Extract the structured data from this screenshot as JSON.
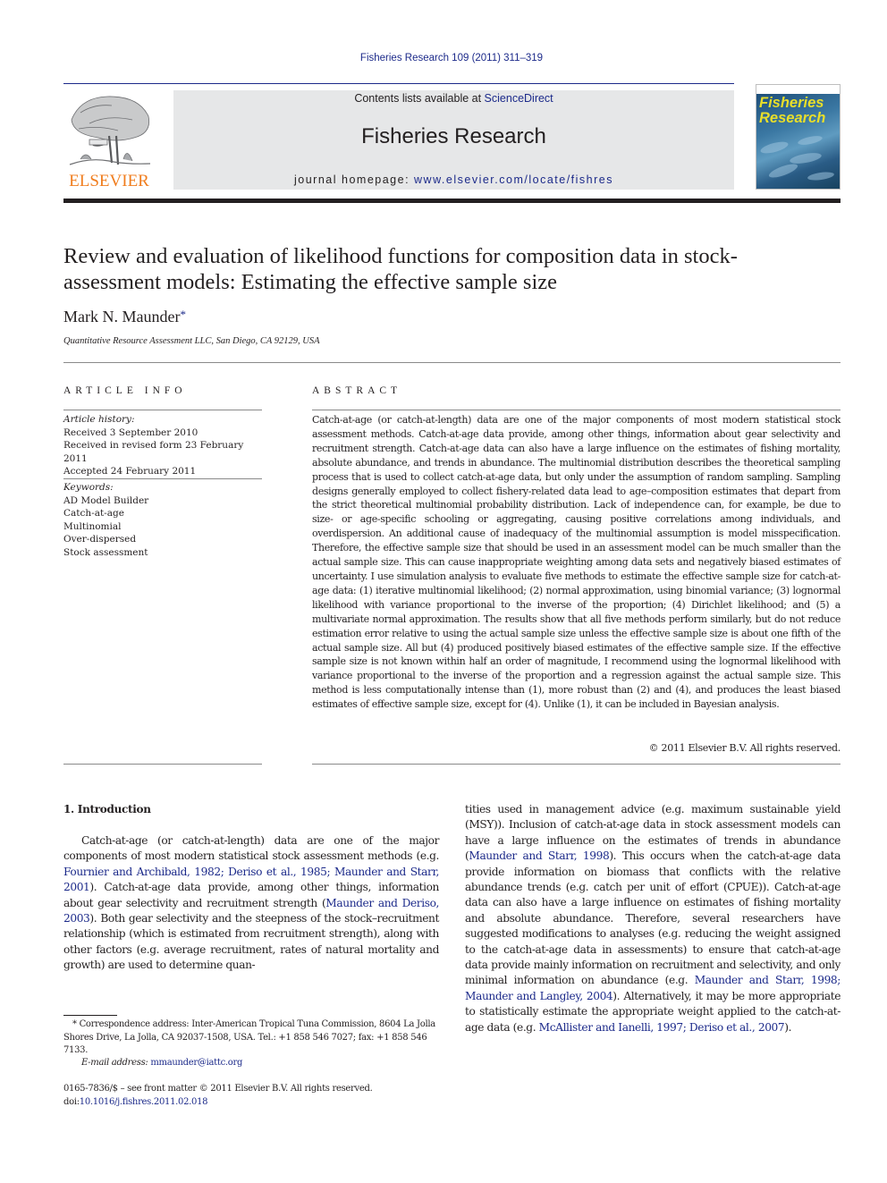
{
  "header": {
    "citation": "Fisheries Research 109 (2011) 311–319",
    "contents_prefix": "Contents lists available at ",
    "contents_link": "ScienceDirect",
    "journal_name": "Fisheries Research",
    "homepage_prefix": "journal homepage: ",
    "homepage_link": "www.elsevier.com/locate/fishres",
    "publisher_logo_text": "ELSEVIER",
    "cover_title_line1": "Fisheries",
    "cover_title_line2": "Research",
    "colors": {
      "link": "#1c2a8a",
      "elsevier_orange": "#f07d1e",
      "cover_title": "#e8de2a",
      "masthead_bg": "#e6e7e8"
    }
  },
  "article": {
    "title": "Review and evaluation of likelihood functions for composition data in stock-assessment models: Estimating the effective sample size",
    "author": "Mark N. Maunder",
    "author_mark": "*",
    "affiliation": "Quantitative Resource Assessment LLC, San Diego, CA 92129, USA"
  },
  "article_info": {
    "heading": "ARTICLE INFO",
    "history_label": "Article history:",
    "history": [
      "Received 3 September 2010",
      "Received in revised form 23 February 2011",
      "Accepted 24 February 2011"
    ],
    "keywords_label": "Keywords:",
    "keywords": [
      "AD Model Builder",
      "Catch-at-age",
      "Multinomial",
      "Over-dispersed",
      "Stock assessment"
    ]
  },
  "abstract": {
    "heading": "ABSTRACT",
    "text": "Catch-at-age (or catch-at-length) data are one of the major components of most modern statistical stock assessment methods. Catch-at-age data provide, among other things, information about gear selectivity and recruitment strength. Catch-at-age data can also have a large influence on the estimates of fishing mortality, absolute abundance, and trends in abundance. The multinomial distribution describes the theoretical sampling process that is used to collect catch-at-age data, but only under the assumption of random sampling. Sampling designs generally employed to collect fishery-related data lead to age–composition estimates that depart from the strict theoretical multinomial probability distribution. Lack of independence can, for example, be due to size- or age-specific schooling or aggregating, causing positive correlations among individuals, and overdispersion. An additional cause of inadequacy of the multinomial assumption is model misspecification. Therefore, the effective sample size that should be used in an assessment model can be much smaller than the actual sample size. This can cause inappropriate weighting among data sets and negatively biased estimates of uncertainty. I use simulation analysis to evaluate five methods to estimate the effective sample size for catch-at-age data: (1) iterative multinomial likelihood; (2) normal approximation, using binomial variance; (3) lognormal likelihood with variance proportional to the inverse of the proportion; (4) Dirichlet likelihood; and (5) a multivariate normal approximation. The results show that all five methods perform similarly, but do not reduce estimation error relative to using the actual sample size unless the effective sample size is about one fifth of the actual sample size. All but (4) produced positively biased estimates of the effective sample size. If the effective sample size is not known within half an order of magnitude, I recommend using the lognormal likelihood with variance proportional to the inverse of the proportion and a regression against the actual sample size. This method is less computationally intense than (1), more robust than (2) and (4), and produces the least biased estimates of effective sample size, except for (4). Unlike (1), it can be included in Bayesian analysis.",
    "copyright": "© 2011 Elsevier B.V. All rights reserved."
  },
  "introduction": {
    "heading": "1.  Introduction",
    "left": [
      {
        "t": "Catch-at-age (or catch-at-length) data are one of the major components of most modern statistical stock assessment methods (e.g. "
      },
      {
        "t": "Fournier and Archibald, 1982; Deriso et al., 1985; Maunder and Starr, 2001",
        "link": true
      },
      {
        "t": "). Catch-at-age data provide, among other things, information about gear selectivity and recruitment strength ("
      },
      {
        "t": "Maunder and Deriso, 2003",
        "link": true
      },
      {
        "t": "). Both gear selectivity and the steepness of the stock–recruitment relationship (which is estimated from recruitment strength), along with other factors (e.g. average recruitment, rates of natural mortality and growth) are used to determine quan-"
      }
    ],
    "right": [
      {
        "t": "tities used in management advice (e.g. maximum sustainable yield (MSY)). Inclusion of catch-at-age data in stock assessment models can have a large influence on the estimates of trends in abundance ("
      },
      {
        "t": "Maunder and Starr, 1998",
        "link": true
      },
      {
        "t": "). This occurs when the catch-at-age data provide information on biomass that conflicts with the relative abundance trends (e.g. catch per unit of effort (CPUE)). Catch-at-age data can also have a large influence on estimates of fishing mortality and absolute abundance. Therefore, several researchers have suggested modifications to analyses (e.g. reducing the weight assigned to the catch-at-age data in assessments) to ensure that catch-at-age data provide mainly information on recruitment and selectivity, and only minimal information on abundance (e.g. "
      },
      {
        "t": "Maunder and Starr, 1998; Maunder and Langley, 2004",
        "link": true
      },
      {
        "t": "). Alternatively, it may be more appropriate to statistically estimate the appropriate weight applied to the catch-at-age data (e.g. "
      },
      {
        "t": "McAllister and Ianelli, 1997; Deriso et al., 2007",
        "link": true
      },
      {
        "t": ")."
      }
    ]
  },
  "footnotes": {
    "correspondence": "* Correspondence address: Inter-American Tropical Tuna Commission, 8604 La Jolla Shores Drive, La Jolla, CA 92037-1508, USA. Tel.: +1 858 546 7027; fax: +1 858 546 7133.",
    "email_label": "E-mail address: ",
    "email": "mmaunder@iattc.org",
    "issn": "0165-7836/$ – see front matter © 2011 Elsevier B.V. All rights reserved.",
    "doi_prefix": "doi:",
    "doi": "10.1016/j.fishres.2011.02.018"
  }
}
